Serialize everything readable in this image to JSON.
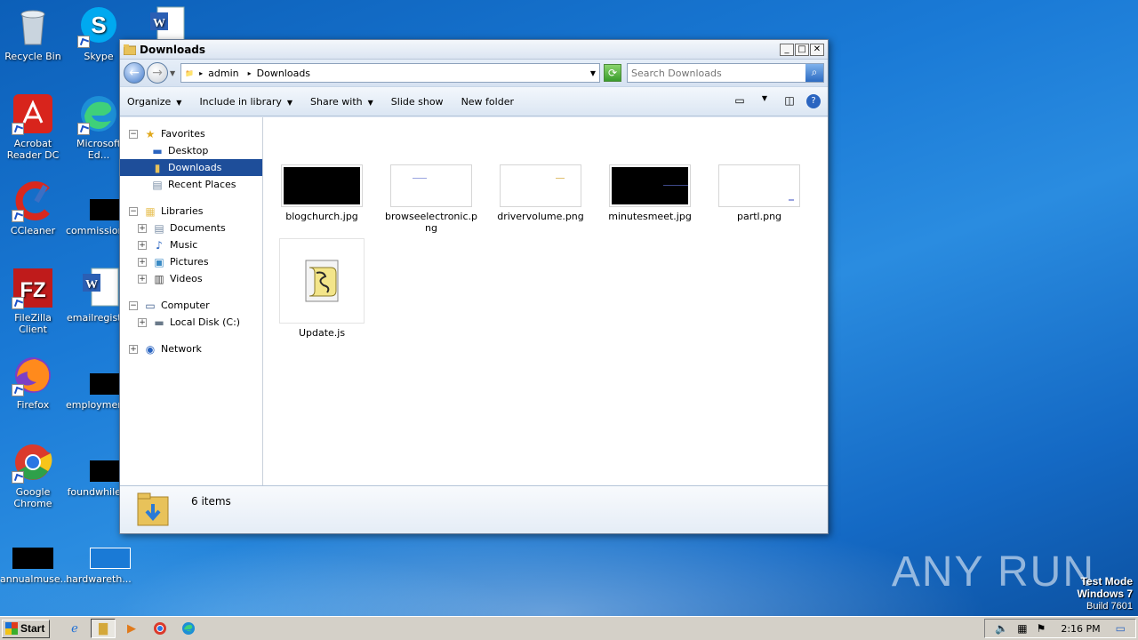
{
  "desktop": {
    "icons": [
      {
        "label": "Recycle Bin"
      },
      {
        "label": "Skype"
      },
      {
        "label": "Acrobat Reader DC"
      },
      {
        "label": "Microsoft Ed..."
      },
      {
        "label": "CCleaner"
      },
      {
        "label": "commission..."
      },
      {
        "label": "FileZilla Client"
      },
      {
        "label": "emailregist..."
      },
      {
        "label": "Firefox"
      },
      {
        "label": "employmen..."
      },
      {
        "label": "Google Chrome"
      },
      {
        "label": "foundwhile..."
      },
      {
        "label": "annualmuse..."
      },
      {
        "label": "hardwareth..."
      }
    ]
  },
  "window": {
    "title": "Downloads",
    "address": {
      "crumbs": [
        "admin",
        "Downloads"
      ]
    },
    "search": {
      "placeholder": "Search Downloads"
    },
    "toolbar": {
      "organize": "Organize",
      "include_in_library": "Include in library",
      "share_with": "Share with",
      "slide_show": "Slide show",
      "new_folder": "New folder"
    },
    "nav": {
      "favorites": "Favorites",
      "desktop": "Desktop",
      "downloads": "Downloads",
      "recent_places": "Recent Places",
      "libraries": "Libraries",
      "documents": "Documents",
      "music": "Music",
      "pictures": "Pictures",
      "videos": "Videos",
      "computer": "Computer",
      "local_disk": "Local Disk (C:)",
      "network": "Network"
    },
    "files": [
      {
        "name": "blogchurch.jpg",
        "thumb": "black"
      },
      {
        "name": "browseelectronic.png",
        "thumb": "white"
      },
      {
        "name": "drivervolume.png",
        "thumb": "white"
      },
      {
        "name": "minutesmeet.jpg",
        "thumb": "black"
      },
      {
        "name": "partl.png",
        "thumb": "white"
      },
      {
        "name": "Update.js",
        "thumb": "script"
      }
    ],
    "status": {
      "count": "6 items"
    }
  },
  "taskbar": {
    "start": "Start",
    "clock": "2:16 PM"
  },
  "watermark": {
    "text": "ANY RUN"
  },
  "testmode": {
    "line1": "Test Mode",
    "line2": "Windows 7",
    "line3": "Build 7601"
  },
  "colors": {
    "selection": "#1e4e9a",
    "desktop": "#1a7ad6"
  }
}
